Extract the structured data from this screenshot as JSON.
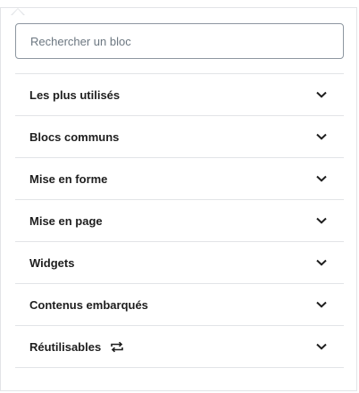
{
  "search": {
    "placeholder": "Rechercher un bloc",
    "value": ""
  },
  "panels": [
    {
      "label": "Les plus utilisés",
      "icon": "chevron-down-icon"
    },
    {
      "label": "Blocs communs",
      "icon": "chevron-down-icon"
    },
    {
      "label": "Mise en forme",
      "icon": "chevron-down-icon"
    },
    {
      "label": "Mise en page",
      "icon": "chevron-down-icon"
    },
    {
      "label": "Widgets",
      "icon": "chevron-down-icon"
    },
    {
      "label": "Contenus embarqués",
      "icon": "chevron-down-icon"
    },
    {
      "label": "Réutilisables",
      "icon": "chevron-down-icon",
      "extra_icon": "reusable-block-icon"
    }
  ],
  "colors": {
    "border": "#e2e4e7",
    "input_border": "#8d96a0",
    "text": "#1e1e1e",
    "placeholder": "#6c7781"
  }
}
